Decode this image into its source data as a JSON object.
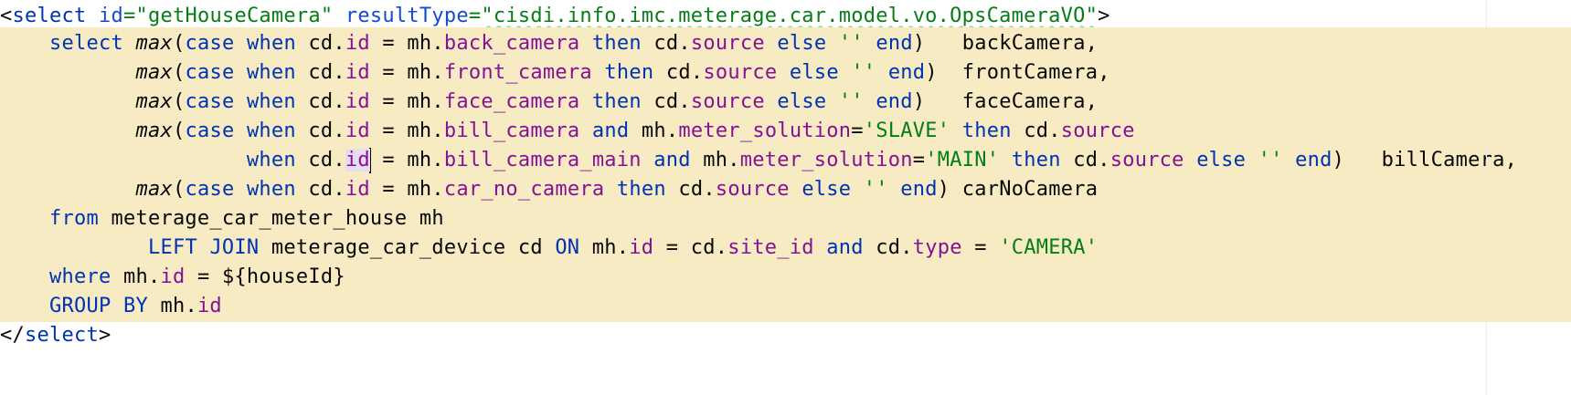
{
  "editor": {
    "language": "xml/sql (MyBatis mapper)",
    "colors": {
      "highlight_background": "#f6ebc3",
      "keyword": "#0033b3",
      "field": "#871094",
      "string": "#067d17",
      "text": "#080808"
    },
    "lines": {
      "l1": {
        "open_bracket": "<",
        "tag": "select",
        "attr1_name": "id",
        "eq1": "=",
        "attr1_value": "\"getHouseCamera\"",
        "attr2_name": "resultType",
        "eq2": "=",
        "attr2_value": "\"cisdi.info.imc.meterage.car.model.vo.OpsCameraVO\"",
        "close_bracket": ">"
      },
      "l2": {
        "indent": "    ",
        "kw_select": "select",
        "fn": "max",
        "t1": "(",
        "kw_case": "case",
        "kw_when": "when",
        "t2": "cd.",
        "f_id": "id",
        "t3": " = mh.",
        "f_col": "back_camera",
        "kw_then": "then",
        "t4": "cd.",
        "f_source": "source",
        "kw_else": "else",
        "str": "''",
        "kw_end": "end",
        "t5": ")   backCamera,"
      },
      "l3": {
        "indent": "           ",
        "fn": "max",
        "t1": "(",
        "kw_case": "case",
        "kw_when": "when",
        "t2": "cd.",
        "f_id": "id",
        "t3": " = mh.",
        "f_col": "front_camera",
        "kw_then": "then",
        "t4": "cd.",
        "f_source": "source",
        "kw_else": "else",
        "str": "''",
        "kw_end": "end",
        "t5": ")  frontCamera,"
      },
      "l4": {
        "indent": "           ",
        "fn": "max",
        "t1": "(",
        "kw_case": "case",
        "kw_when": "when",
        "t2": "cd.",
        "f_id": "id",
        "t3": " = mh.",
        "f_col": "face_camera",
        "kw_then": "then",
        "t4": "cd.",
        "f_source": "source",
        "kw_else": "else",
        "str": "''",
        "kw_end": "end",
        "t5": ")   faceCamera,"
      },
      "l5": {
        "indent": "           ",
        "fn": "max",
        "t1": "(",
        "kw_case": "case",
        "kw_when": "when",
        "t2": "cd.",
        "f_id": "id",
        "t3": " = mh.",
        "f_col": "bill_camera",
        "kw_and": "and",
        "t4": "mh.",
        "f_sol": "meter_solution",
        "t5": "=",
        "str": "'SLAVE'",
        "kw_then": "then",
        "t6": "cd.",
        "f_source": "source"
      },
      "l6": {
        "indent": "                    ",
        "kw_when": "when",
        "t1": "cd.",
        "f_id": "id",
        "t2": " = mh.",
        "f_col": "bill_camera_main",
        "kw_and": "and",
        "t3": "mh.",
        "f_sol": "meter_solution",
        "t4": "=",
        "str1": "'MAIN'",
        "kw_then": "then",
        "t5": "cd.",
        "f_source": "source",
        "kw_else": "else",
        "str2": "''",
        "kw_end": "end",
        "t6": ")   billCamera,"
      },
      "l7": {
        "indent": "           ",
        "fn": "max",
        "t1": "(",
        "kw_case": "case",
        "kw_when": "when",
        "t2": "cd.",
        "f_id": "id",
        "t3": " = mh.",
        "f_col": "car_no_camera",
        "kw_then": "then",
        "t4": "cd.",
        "f_source": "source",
        "kw_else": "else",
        "str": "''",
        "kw_end": "end",
        "t5": ") carNoCamera"
      },
      "l8": {
        "indent": "    ",
        "kw_from": "from",
        "t1": " meterage_car_meter_house mh"
      },
      "l9": {
        "indent": "            ",
        "kw_left": "LEFT",
        "kw_join": "JOIN",
        "t1": " meterage_car_device cd ",
        "kw_on": "ON",
        "t2": " mh.",
        "f_id": "id",
        "t3": " = cd.",
        "f_site": "site_id",
        "kw_and": "and",
        "t4": "cd.",
        "f_type": "type",
        "t5": " = ",
        "str": "'CAMERA'"
      },
      "l10": {
        "indent": "    ",
        "kw_where": "where",
        "t1": " mh.",
        "f_id": "id",
        "t2": " = ${houseId}"
      },
      "l11": {
        "indent": "    ",
        "kw_group": "GROUP BY",
        "t1": " mh.",
        "f_id": "id"
      },
      "l12": {
        "open_bracket": "</",
        "tag": "select",
        "close_bracket": ">"
      }
    }
  }
}
